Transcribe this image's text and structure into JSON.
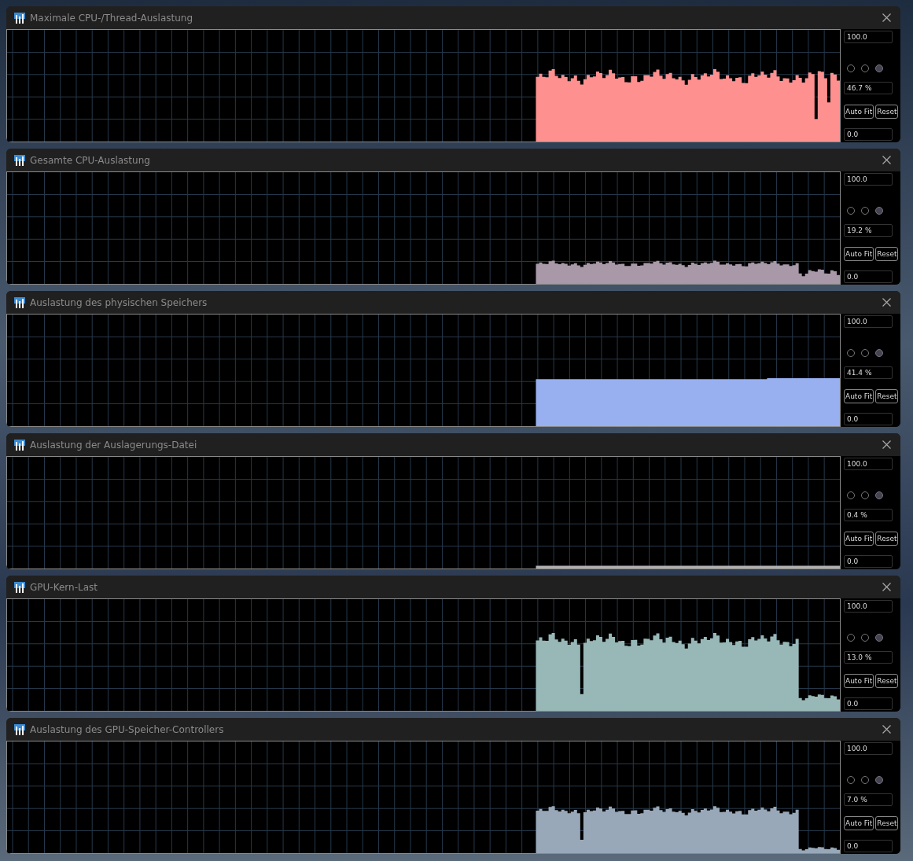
{
  "windows": [
    {
      "title": "Maximale CPU-/Thread-Auslastung",
      "color": "#ff9090",
      "max": "100.0",
      "reading": "46.7 %",
      "min": "0.0",
      "radios": [
        {
          "selected": false
        },
        {
          "selected": false
        },
        {
          "selected": true
        }
      ],
      "buttons": [
        "Auto Fit",
        "Reset"
      ]
    },
    {
      "title": "Gesamte CPU-Auslastung",
      "color": "#a898a8",
      "max": "100.0",
      "reading": "19.2 %",
      "min": "0.0",
      "radios": [
        {
          "selected": false
        },
        {
          "selected": false
        },
        {
          "selected": true
        }
      ],
      "buttons": [
        "Auto Fit",
        "Reset"
      ]
    },
    {
      "title": "Auslastung des physischen Speichers",
      "color": "#98b0f0",
      "max": "100.0",
      "reading": "41.4 %",
      "min": "0.0",
      "radios": [
        {
          "selected": false
        },
        {
          "selected": false
        },
        {
          "selected": true
        }
      ],
      "buttons": [
        "Auto Fit",
        "Reset"
      ]
    },
    {
      "title": "Auslastung der Auslagerungs-Datei",
      "color": "#b0b0b0",
      "max": "100.0",
      "reading": "0.4 %",
      "min": "0.0",
      "radios": [
        {
          "selected": false
        },
        {
          "selected": false
        },
        {
          "selected": true
        }
      ],
      "buttons": [
        "Auto Fit",
        "Reset"
      ]
    },
    {
      "title": "GPU-Kern-Last",
      "color": "#98b8b8",
      "max": "100.0",
      "reading": "13.0 %",
      "min": "0.0",
      "radios": [
        {
          "selected": false
        },
        {
          "selected": false
        },
        {
          "selected": true
        }
      ],
      "buttons": [
        "Auto Fit",
        "Reset"
      ]
    },
    {
      "title": "Auslastung des GPU-Speicher-Controllers",
      "color": "#98a8b8",
      "max": "100.0",
      "reading": "7.0 %",
      "min": "0.0",
      "radios": [
        {
          "selected": false
        },
        {
          "selected": false
        },
        {
          "selected": true
        }
      ],
      "buttons": [
        "Auto Fit",
        "Reset"
      ]
    }
  ]
}
